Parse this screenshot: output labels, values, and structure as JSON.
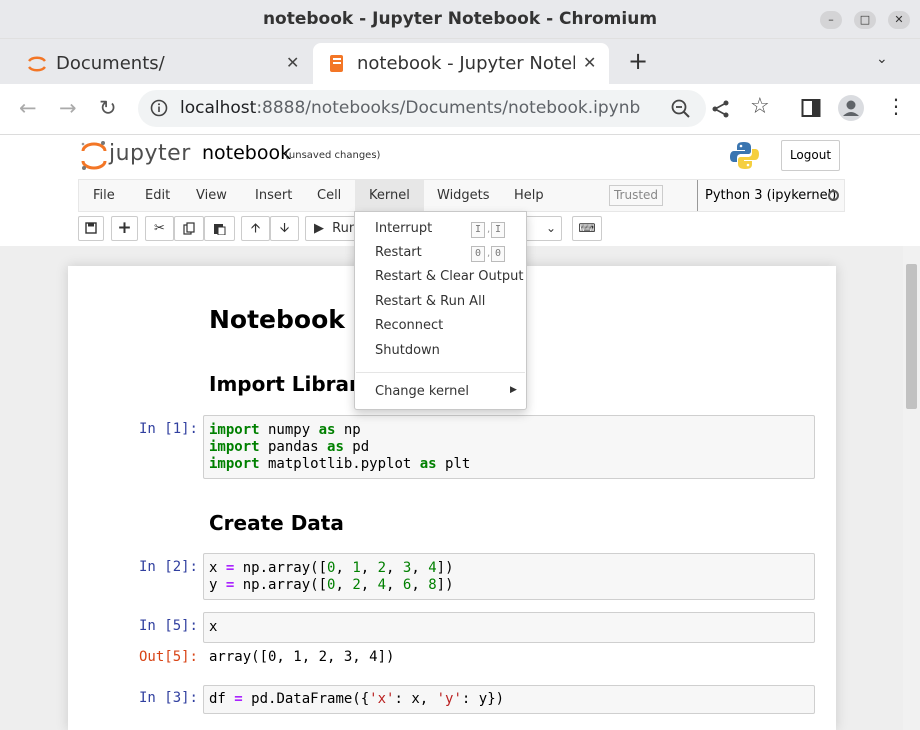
{
  "window": {
    "title": "notebook - Jupyter Notebook - Chromium"
  },
  "tabs": [
    {
      "label": "Documents/",
      "active": false
    },
    {
      "label": "notebook - Jupyter Noteb",
      "active": true
    }
  ],
  "address": {
    "host": "localhost",
    "rest": ":8888/notebooks/Documents/notebook.ipynb"
  },
  "jupyter": {
    "brand": "jupyter",
    "notebook_name": "notebook",
    "save_status": "(unsaved changes)",
    "logout_label": "Logout"
  },
  "menubar": {
    "items": [
      "File",
      "Edit",
      "View",
      "Insert",
      "Cell",
      "Kernel",
      "Widgets",
      "Help"
    ],
    "trusted_label": "Trusted",
    "kernel_name": "Python 3 (ipykernel)"
  },
  "toolbar": {
    "run_label": "Run"
  },
  "kernel_menu": {
    "interrupt": "Interrupt",
    "restart": "Restart",
    "restart_clear": "Restart & Clear Output",
    "restart_run_all": "Restart & Run All",
    "reconnect": "Reconnect",
    "shutdown": "Shutdown",
    "change_kernel": "Change kernel",
    "interrupt_keys": [
      "I",
      "I"
    ],
    "restart_keys": [
      "0",
      "0"
    ]
  },
  "notebook": {
    "title": "Notebook",
    "sections": [
      "Import Libraries",
      "Create Data"
    ],
    "prompts": [
      "In [1]:",
      "In [2]:",
      "In [5]:",
      "Out[5]:",
      "In [3]:"
    ],
    "out_5": "array([0, 1, 2, 3, 4])"
  },
  "colors": {
    "accent_orange": "#f37626",
    "prompt_in": "#303f9f",
    "prompt_out": "#d84315"
  }
}
